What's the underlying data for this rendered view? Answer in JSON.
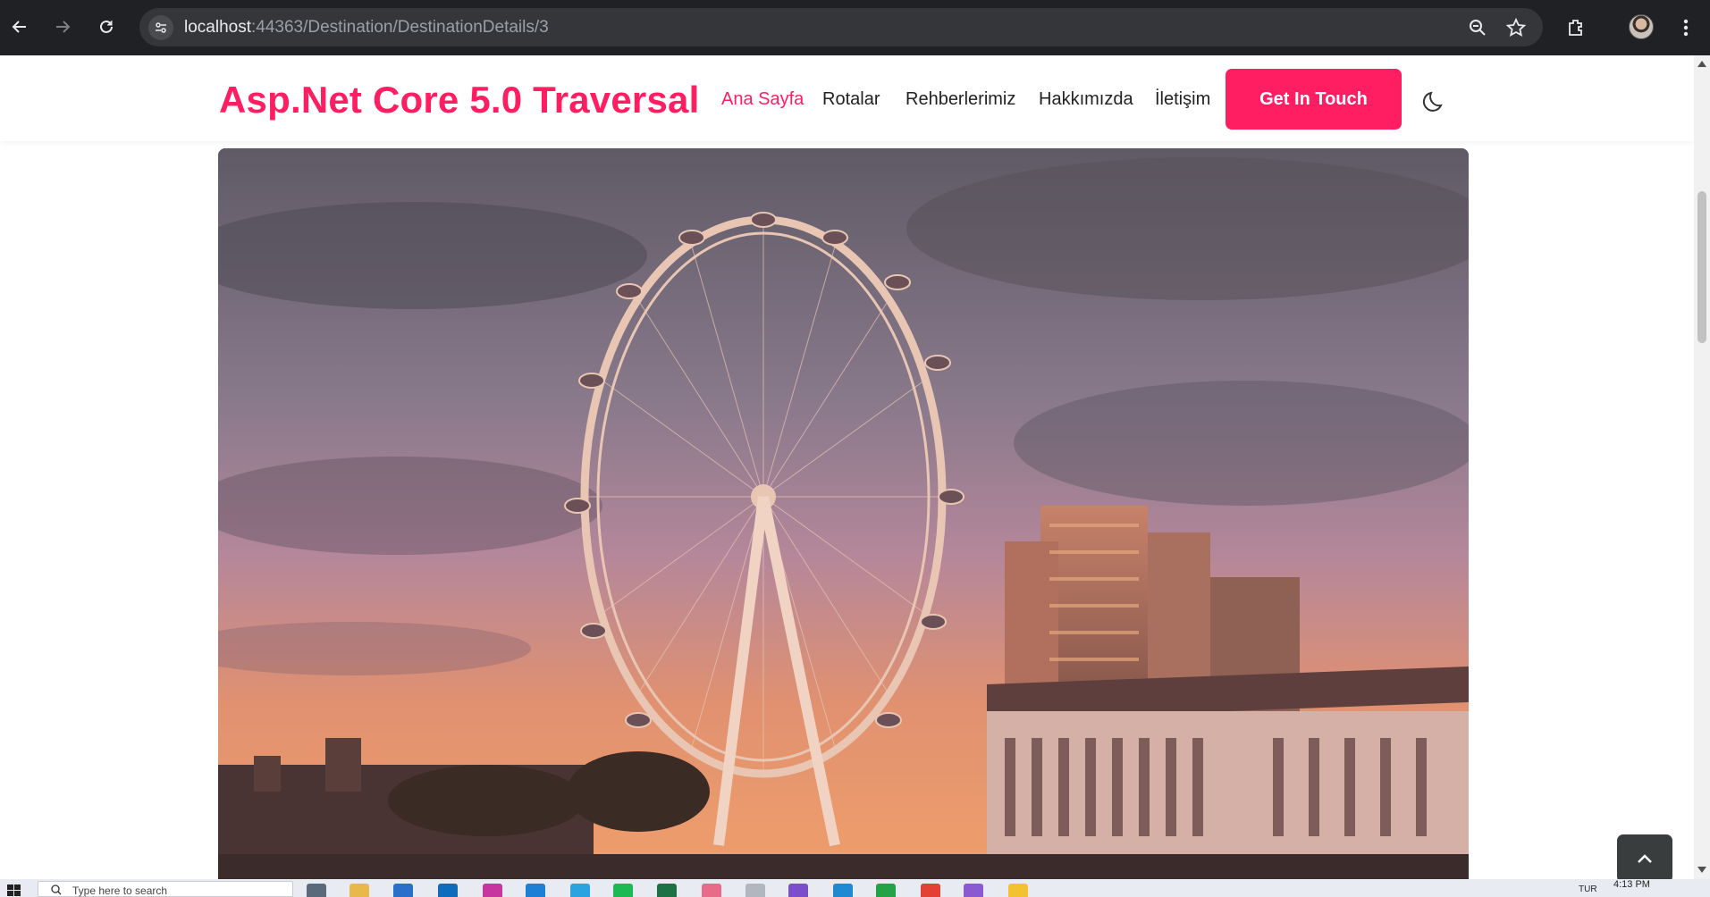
{
  "browser": {
    "url_host": "localhost",
    "url_path": ":44363/Destination/DestinationDetails/3"
  },
  "site": {
    "logo": "Asp.Net Core 5.0 Traversal",
    "nav": [
      {
        "label": "Ana Sayfa",
        "active": true
      },
      {
        "label": "Rotalar",
        "active": false
      },
      {
        "label": "Rehberlerimiz",
        "active": false
      },
      {
        "label": "Hakkımızda",
        "active": false
      },
      {
        "label": "İletişim",
        "active": false
      }
    ],
    "cta_label": "Get In Touch",
    "accent_color": "#ff1e62",
    "theme_toggle_icon": "moon-icon",
    "back_to_top_icon": "chevron-up-icon"
  },
  "taskbar": {
    "search_placeholder": "Type here to search",
    "clock": "4:13 PM",
    "lang": "TUR"
  }
}
